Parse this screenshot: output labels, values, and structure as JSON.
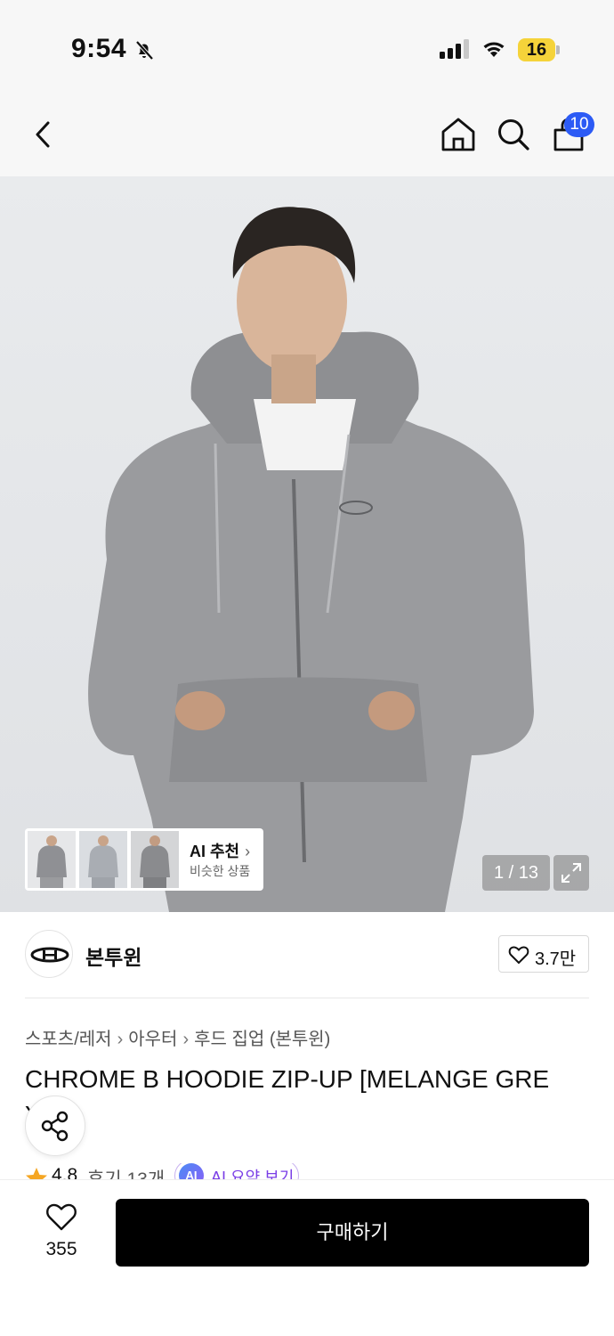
{
  "status_bar": {
    "time": "9:54",
    "battery": "16"
  },
  "header": {
    "cart_count": "10"
  },
  "gallery": {
    "counter": "1 / 13"
  },
  "ai_recommend": {
    "title": "AI 추천",
    "subtitle": "비슷한 상품"
  },
  "brand": {
    "name": "본투윈",
    "likes": "3.7만"
  },
  "breadcrumb": [
    "스포츠/레저",
    "아우터",
    "후드 집업 (본투윈)"
  ],
  "product": {
    "title": "CHROME B HOODIE ZIP-UP [MELANGE GRE",
    "title_overflow": "Y]"
  },
  "rating": {
    "score": "4.8",
    "reviews": "후기 13개",
    "ai_summary_badge": "AI",
    "ai_summary": "AI 요약 보기"
  },
  "bottom_bar": {
    "wish_count": "355",
    "buy_label": "구매하기"
  },
  "colors": {
    "badge_blue": "#2c5bf5",
    "battery_yellow": "#f5d33a",
    "ai_purple": "#7a3ee6",
    "star": "#f5a623"
  }
}
